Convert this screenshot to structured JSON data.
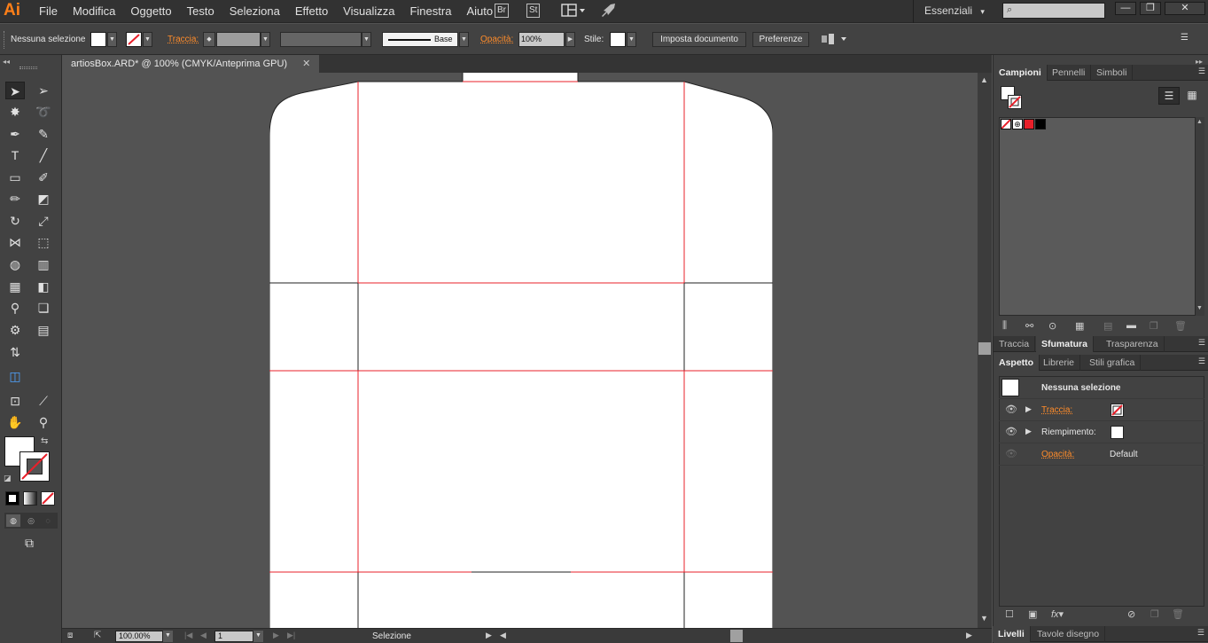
{
  "app": {
    "logo": "Ai"
  },
  "menu": [
    "File",
    "Modifica",
    "Oggetto",
    "Testo",
    "Seleziona",
    "Effetto",
    "Visualizza",
    "Finestra",
    "Aiuto"
  ],
  "app_buttons": {
    "bridge": "Br",
    "stock": "St"
  },
  "workspace": {
    "label": "Essenziali",
    "arrow": "▾"
  },
  "search": {
    "placeholder": "⌕"
  },
  "window": {
    "minimize": "—",
    "restore": "❐",
    "close": "✕"
  },
  "controlbar": {
    "selection": "Nessuna selezione",
    "stroke_label": "Traccia:",
    "stroke_style": "Base",
    "opacity_label": "Opacità:",
    "opacity_value": "100%",
    "style_label": "Stile:",
    "doc_setup": "Imposta documento",
    "prefs": "Preferenze"
  },
  "document": {
    "tab_title": "artiosBox.ARD* @ 100% (CMYK/Anteprima GPU)",
    "close": "✕"
  },
  "statusbar": {
    "zoom": "100.00%",
    "page": "1",
    "tool": "Selezione"
  },
  "panels": {
    "swatches_tabs": [
      "Campioni",
      "Pennelli",
      "Simboli"
    ],
    "color_tabs": [
      "Traccia",
      "Sfumatura",
      "Trasparenza"
    ],
    "appearance_tabs": [
      "Aspetto",
      "Librerie",
      "Stili grafica"
    ],
    "layers_tabs": [
      "Livelli",
      "Tavole disegno"
    ],
    "appearance": {
      "title": "Nessuna selezione",
      "stroke": "Traccia:",
      "fill": "Riempimento:",
      "opacity": "Opacità:",
      "opacity_value": "Default"
    }
  },
  "colors": {
    "accent": "#ff8c2a",
    "guide_red": "#e8202a",
    "background": "#535353"
  }
}
